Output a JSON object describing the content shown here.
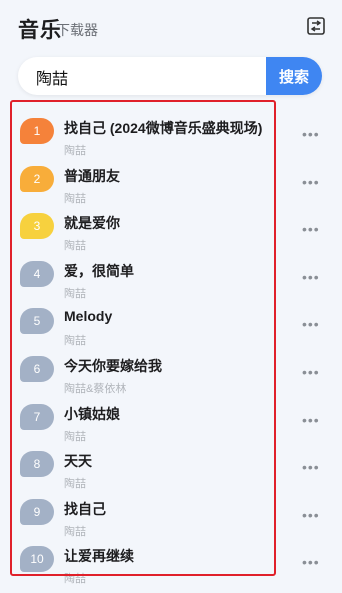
{
  "header": {
    "title": "音乐",
    "subtitle": "下载器",
    "icon": "logout-icon"
  },
  "search": {
    "value": "陶喆",
    "button_label": "搜索"
  },
  "more_label": "•••",
  "songs": [
    {
      "rank": "1",
      "title": "找自己 (2024微博音乐盛典现场)",
      "artist": "陶喆",
      "color": "#f5823a"
    },
    {
      "rank": "2",
      "title": "普通朋友",
      "artist": "陶喆",
      "color": "#f8ad3a"
    },
    {
      "rank": "3",
      "title": "就是爱你",
      "artist": "陶喆",
      "color": "#f7d13e"
    },
    {
      "rank": "4",
      "title": "爱，很简单",
      "artist": "陶喆",
      "color": "#a3b1c6"
    },
    {
      "rank": "5",
      "title": "Melody",
      "artist": "陶喆",
      "color": "#a3b1c6"
    },
    {
      "rank": "6",
      "title": "今天你要嫁给我",
      "artist": "陶喆&蔡依林",
      "color": "#a3b1c6"
    },
    {
      "rank": "7",
      "title": "小镇姑娘",
      "artist": "陶喆",
      "color": "#a3b1c6"
    },
    {
      "rank": "8",
      "title": "天天",
      "artist": "陶喆",
      "color": "#a3b1c6"
    },
    {
      "rank": "9",
      "title": "找自己",
      "artist": "陶喆",
      "color": "#a3b1c6"
    },
    {
      "rank": "10",
      "title": "让爱再继续",
      "artist": "陶喆",
      "color": "#a3b1c6"
    }
  ]
}
